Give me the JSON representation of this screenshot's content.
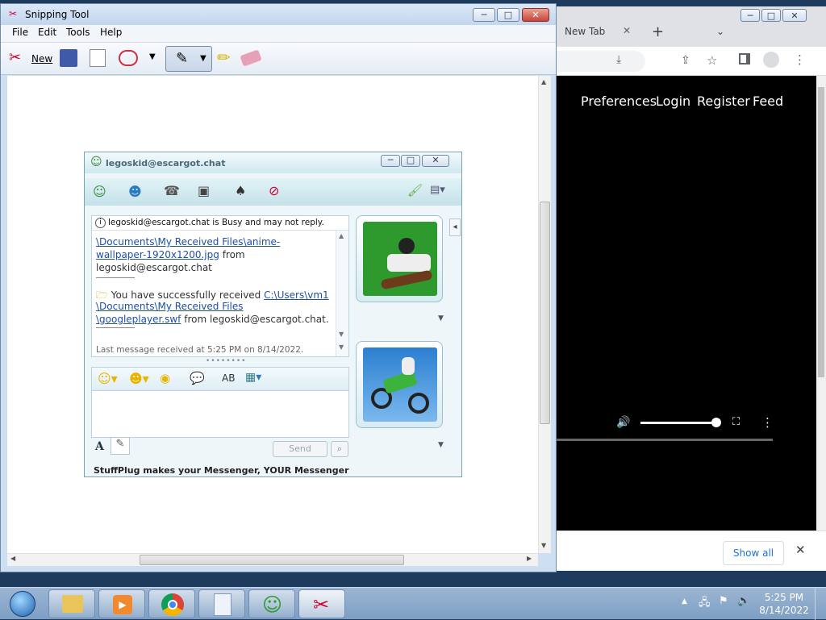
{
  "snipping_tool": {
    "title": "Snipping Tool",
    "menu": [
      "File",
      "Edit",
      "Tools",
      "Help"
    ],
    "new_label": "New",
    "controls": {
      "minimize": "─",
      "maximize": "□",
      "close": "✕"
    }
  },
  "chrome": {
    "tab_title": "New Tab",
    "tab_close": "✕",
    "new_tab": "+",
    "site_nav": [
      "Preferences",
      "Login",
      "Register",
      "Feed"
    ],
    "downloads_show_all": "Show all",
    "downloads_close": "✕"
  },
  "messenger": {
    "title": "legoskid@escargot.chat",
    "status_notice": "legoskid@escargot.chat is Busy and may not reply.",
    "messages": {
      "msg1_path_a": "\\Documents\\My Received Files\\anime-",
      "msg1_path_b": "wallpaper-1920x1200.jpg",
      "msg1_from_word": " from",
      "msg1_sender": "legoskid@escargot.chat",
      "msg2_prefix": "You have successfully received ",
      "msg2_path_a": "C:\\Users\\vm1",
      "msg2_path_b": "\\Documents\\My Received Files",
      "msg2_path_c": "\\googleplayer.swf",
      "msg2_from": " from legoskid@escargot.chat."
    },
    "last_message": "Last message received at 5:25 PM on 8/14/2022.",
    "send_label": "Send",
    "footer": "StuffPlug makes your Messenger, YOUR Messenger"
  },
  "taskbar": {
    "time": "5:25 PM",
    "date": "8/14/2022"
  },
  "colors": {
    "link": "#1f4ea8",
    "taskbar": "#7d9ec3",
    "close_button": "#c7453a"
  }
}
